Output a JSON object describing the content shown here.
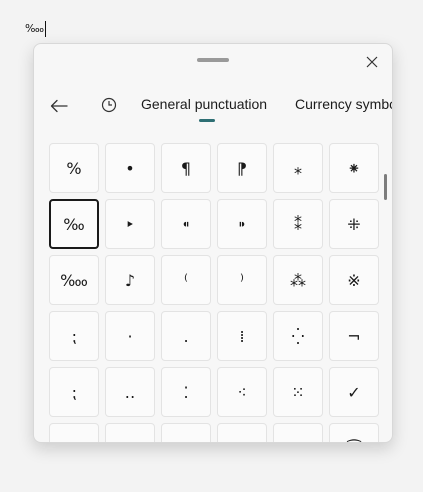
{
  "document": {
    "text": "‱"
  },
  "panel": {
    "tabs": [
      {
        "label": "General punctuation"
      },
      {
        "label": "Currency symbols"
      }
    ],
    "icons": {
      "close": "close-icon",
      "back": "back-arrow-icon",
      "recent": "clock-icon"
    },
    "accent_color": "#2e6f74",
    "selected_symbol": "‰",
    "symbols": [
      "%",
      "•",
      "¶",
      "⁋",
      "⁎",
      "⁕",
      "‰",
      "‣",
      "⁌",
      "⁍",
      "⁑",
      "⁜",
      "‱",
      "♪",
      "⁽",
      "⁾",
      "⁂",
      "※",
      "⁏",
      "·",
      "․",
      "⁞",
      "⁛",
      "¬",
      "⁏",
      "‥",
      "⁚",
      "⁖",
      "⁙",
      "✓",
      "",
      "",
      "⁝",
      "",
      "",
      "⁐"
    ]
  }
}
